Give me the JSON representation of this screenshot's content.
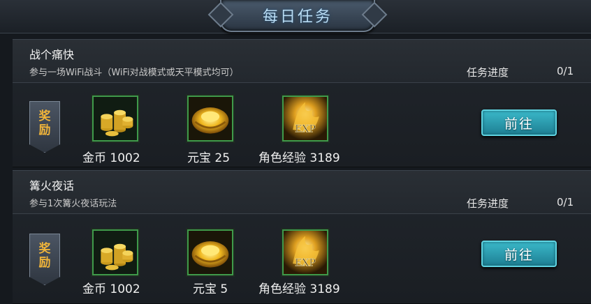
{
  "header": {
    "title": "每日任务"
  },
  "tasks": [
    {
      "name": "战个痛快",
      "desc": "参与一场WiFi战斗（WiFi对战模式或天平模式均可）",
      "progress_label": "任务进度",
      "progress_value": "0/1",
      "reward_tag": [
        "奖",
        "励"
      ],
      "rewards": [
        {
          "icon": "gold-coins-icon",
          "label": "金币 1002"
        },
        {
          "icon": "gold-ingot-icon",
          "label": "元宝 25"
        },
        {
          "icon": "exp-icon",
          "label": "角色经验 3189"
        }
      ],
      "button": "前往"
    },
    {
      "name": "篝火夜话",
      "desc": "参与1次篝火夜话玩法",
      "progress_label": "任务进度",
      "progress_value": "0/1",
      "reward_tag": [
        "奖",
        "励"
      ],
      "rewards": [
        {
          "icon": "gold-coins-icon",
          "label": "金币 1002"
        },
        {
          "icon": "gold-ingot-icon",
          "label": "元宝 5"
        },
        {
          "icon": "exp-icon",
          "label": "角色经验 3189"
        }
      ],
      "button": "前往"
    }
  ],
  "colors": {
    "accent": "#3ab8c9",
    "reward": "#f0b43a",
    "frame": "#3f9a4a"
  },
  "exp_text": "EXP"
}
